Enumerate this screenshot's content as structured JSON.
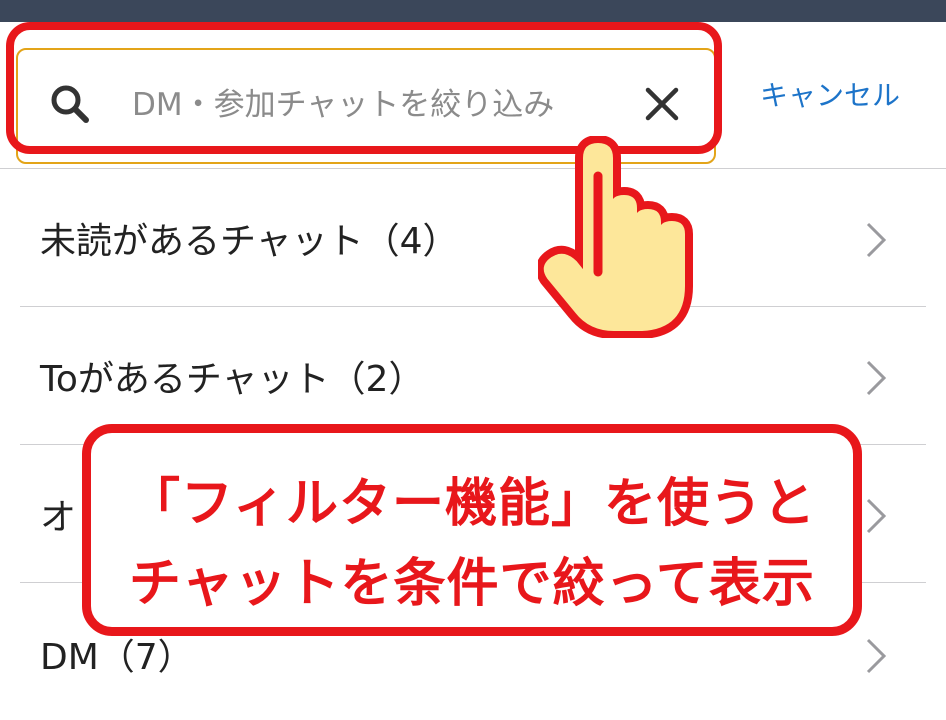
{
  "search": {
    "placeholder": "DM・参加チャットを絞り込み",
    "cancel_label": "キャンセル"
  },
  "filters": [
    {
      "label": "未読があるチャット（4）"
    },
    {
      "label": "Toがあるチャット（2）"
    },
    {
      "label": "オ"
    },
    {
      "label": "DM（7）"
    }
  ],
  "callout": {
    "line1": "「フィルター機能」を使うと",
    "line2": "チャットを条件で絞って表示"
  },
  "colors": {
    "highlight": "#e8171b",
    "search_border": "#e3a419",
    "link": "#1d74c9",
    "topbar": "#3b475a",
    "hand_fill": "#fde79a"
  },
  "icons": [
    "search-icon",
    "close-icon",
    "chevron-right-icon",
    "pointing-hand-icon"
  ]
}
